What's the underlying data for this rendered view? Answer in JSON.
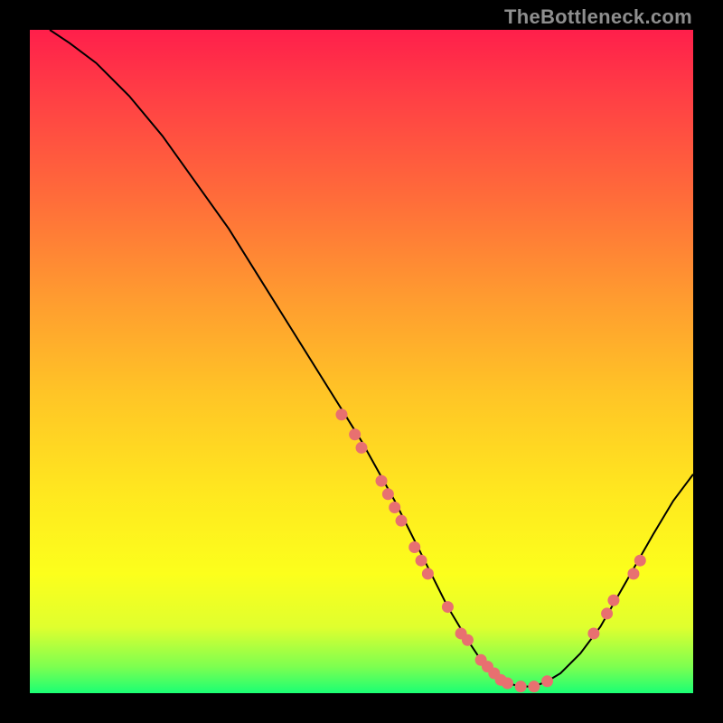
{
  "watermark": "TheBottleneck.com",
  "chart_data": {
    "type": "line",
    "title": "",
    "xlabel": "",
    "ylabel": "",
    "xlim": [
      0,
      100
    ],
    "ylim": [
      0,
      100
    ],
    "colors": {
      "curve": "#000000",
      "points": "#e87070",
      "gradient_top": "#ff1f4b",
      "gradient_bottom": "#1aff74"
    },
    "curve": {
      "x": [
        3,
        6,
        10,
        15,
        20,
        25,
        30,
        35,
        40,
        45,
        50,
        55,
        58,
        60,
        63,
        66,
        68,
        70,
        72,
        74,
        76,
        78,
        80,
        83,
        86,
        90,
        94,
        97,
        100
      ],
      "y": [
        100,
        98,
        95,
        90,
        84,
        77,
        70,
        62,
        54,
        46,
        38,
        29,
        23,
        19,
        13,
        8,
        5,
        3,
        1.5,
        1,
        1,
        1.8,
        3,
        6,
        10,
        17,
        24,
        29,
        33
      ]
    },
    "points": [
      {
        "x": 47,
        "y": 42
      },
      {
        "x": 49,
        "y": 39
      },
      {
        "x": 50,
        "y": 37
      },
      {
        "x": 53,
        "y": 32
      },
      {
        "x": 54,
        "y": 30
      },
      {
        "x": 55,
        "y": 28
      },
      {
        "x": 56,
        "y": 26
      },
      {
        "x": 58,
        "y": 22
      },
      {
        "x": 59,
        "y": 20
      },
      {
        "x": 60,
        "y": 18
      },
      {
        "x": 63,
        "y": 13
      },
      {
        "x": 65,
        "y": 9
      },
      {
        "x": 66,
        "y": 8
      },
      {
        "x": 68,
        "y": 5
      },
      {
        "x": 69,
        "y": 4
      },
      {
        "x": 70,
        "y": 3
      },
      {
        "x": 71,
        "y": 2
      },
      {
        "x": 72,
        "y": 1.5
      },
      {
        "x": 74,
        "y": 1
      },
      {
        "x": 76,
        "y": 1
      },
      {
        "x": 78,
        "y": 1.8
      },
      {
        "x": 85,
        "y": 9
      },
      {
        "x": 87,
        "y": 12
      },
      {
        "x": 88,
        "y": 14
      },
      {
        "x": 91,
        "y": 18
      },
      {
        "x": 92,
        "y": 20
      }
    ]
  }
}
